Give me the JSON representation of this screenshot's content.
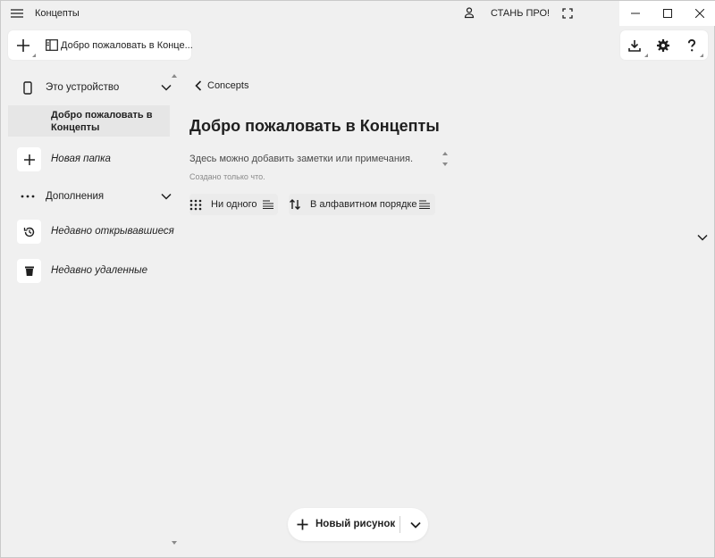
{
  "titlebar": {
    "app_title": "Концепты",
    "pro_label": "СТАНЬ ПРО!",
    "icons": [
      "hamburger-icon",
      "user-icon",
      "fullscreen-icon",
      "minimize-icon",
      "maximize-icon",
      "close-icon"
    ]
  },
  "toolbar": {
    "tab_label": "Добро пожаловать в Концепты",
    "tab_label_display": "Добро пожаловать в Конце...",
    "right_icons": [
      "download-icon",
      "gear-icon",
      "help-icon"
    ]
  },
  "sidebar": {
    "device_section": "Это устройство",
    "selected_item": "Добро пожаловать в Концепты",
    "new_folder": "Новая папка",
    "extras_section": "Дополнения",
    "recent_opened": "Недавно открывавшиеся",
    "recent_deleted": "Недавно удаленные"
  },
  "main": {
    "breadcrumb": "Concepts",
    "title": "Добро пожаловать в Концепты",
    "notes_placeholder": "Здесь можно добавить заметки или примечания.",
    "created_label": "Создано только что.",
    "grouping_label": "Ни одного",
    "sort_label": "В алфавитном порядке"
  },
  "bottom": {
    "new_drawing_label": "Новый рисунок"
  },
  "colors": {
    "background": "#f0f0f0",
    "card": "#ffffff",
    "selected": "#e6e6e6",
    "text": "#1f1f1f"
  }
}
